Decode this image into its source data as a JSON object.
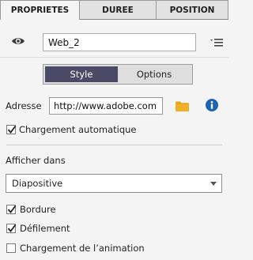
{
  "tabs": [
    {
      "label": "PROPRIETES",
      "active": true
    },
    {
      "label": "DUREE",
      "active": false
    },
    {
      "label": "POSITION",
      "active": false
    }
  ],
  "name_field": {
    "value": "Web_2"
  },
  "icons": {
    "visibility": "eye-icon",
    "options_menu": "list-menu-icon",
    "browse": "folder-icon",
    "info": "info-icon"
  },
  "segmented": {
    "style_label": "Style",
    "options_label": "Options",
    "selected": "Style"
  },
  "address": {
    "label": "Adresse",
    "value": "http://www.adobe.com"
  },
  "auto_load": {
    "label": "Chargement automatique",
    "checked": true
  },
  "display_in": {
    "label": "Afficher dans",
    "selected": "Diapositive"
  },
  "checkboxes": {
    "border": {
      "label": "Bordure",
      "checked": true
    },
    "scroll": {
      "label": "Défilement",
      "checked": true
    },
    "loading_animation": {
      "label": "Chargement de l’animation",
      "checked": false
    }
  },
  "colors": {
    "accent": "#4a4a66",
    "folder": "#e8a21b",
    "info": "#1f63b3"
  }
}
